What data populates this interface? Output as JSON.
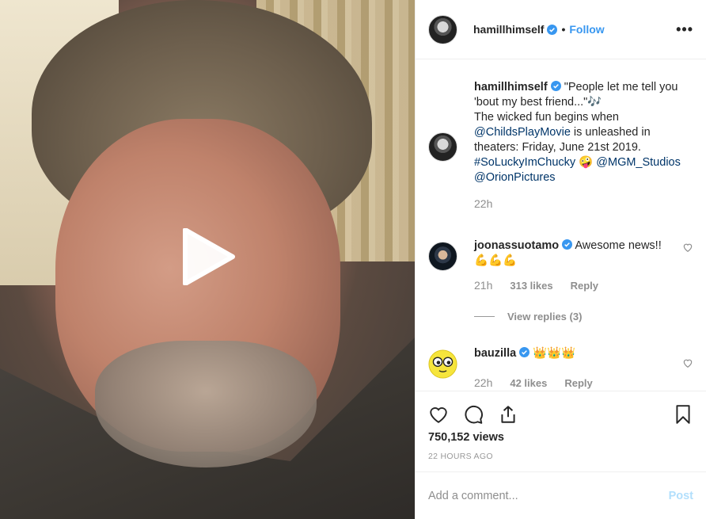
{
  "post": {
    "username": "hamillhimself",
    "follow_label": "Follow",
    "dot": "•",
    "more_label": "•••"
  },
  "caption": {
    "username": "hamillhimself",
    "text_parts": {
      "line1": " \"People let me tell you 'bout my best friend...\"🎶",
      "line2": "The wicked fun begins when ",
      "mention1": "@ChildsPlayMovie",
      "line3": " is unleashed in theaters: Friday, June 21st 2019.",
      "hashtag": "#SoLuckyImChucky",
      "emoji": " 🤪 ",
      "mention2": "@MGM_Studios",
      "mention3": "@OrionPictures"
    },
    "time": "22h"
  },
  "comments": [
    {
      "username": "joonassuotamo",
      "text": " Awesome news!!💪💪💪",
      "time": "21h",
      "likes": "313 likes",
      "reply_label": "Reply",
      "view_replies": "View replies (3)"
    },
    {
      "username": "bauzilla",
      "text": " 👑👑👑",
      "time": "22h",
      "likes": "42 likes",
      "reply_label": "Reply"
    }
  ],
  "stats": {
    "views": "750,152 views",
    "ago": "22 HOURS AGO"
  },
  "add_comment": {
    "placeholder": "Add a comment...",
    "post_label": "Post"
  },
  "colors": {
    "link": "#003569",
    "follow": "#3897f0",
    "muted": "#8e8e8e",
    "post_disabled": "#b2dffc"
  }
}
